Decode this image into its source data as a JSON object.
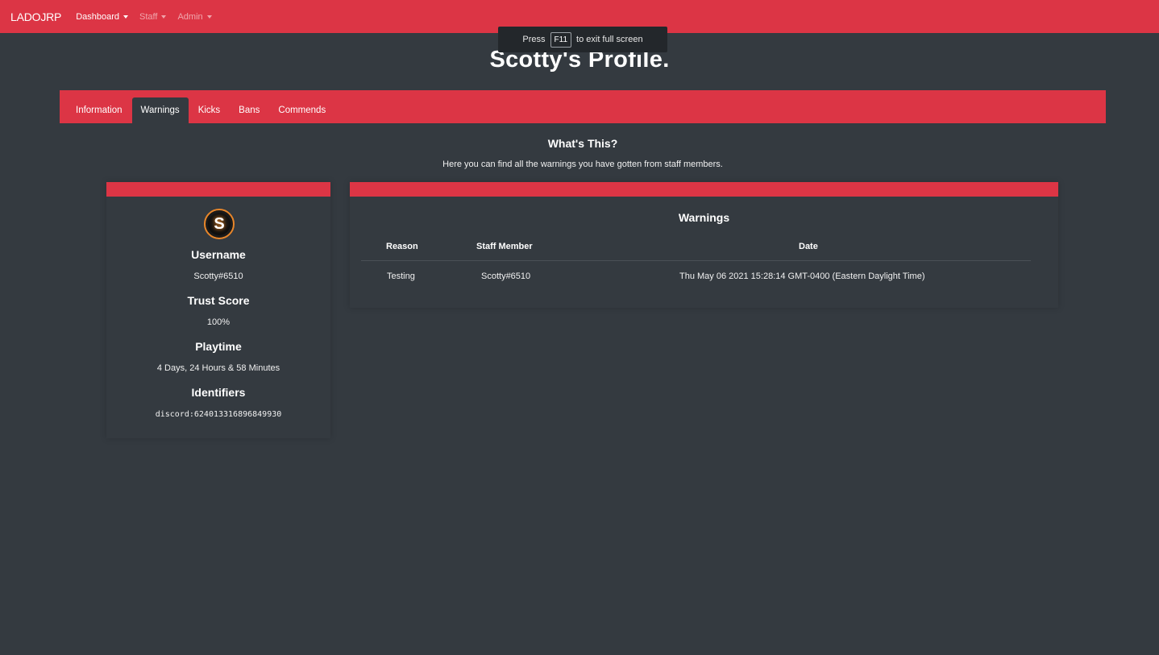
{
  "navbar": {
    "brand": "LADOJRP",
    "items": [
      {
        "label": "Dashboard"
      },
      {
        "label": "Staff"
      },
      {
        "label": "Admin"
      }
    ]
  },
  "fullscreen_toast": {
    "prefix": "Press",
    "key": "F11",
    "suffix": "to exit full screen"
  },
  "page": {
    "title": "Scotty's Profile."
  },
  "tabs": [
    {
      "label": "Information"
    },
    {
      "label": "Warnings"
    },
    {
      "label": "Kicks"
    },
    {
      "label": "Bans"
    },
    {
      "label": "Commends"
    }
  ],
  "info": {
    "heading": "What's This?",
    "description": "Here you can find all the warnings you have gotten from staff members."
  },
  "profile": {
    "avatar_letter": "S",
    "username_label": "Username",
    "username": "Scotty#6510",
    "trust_label": "Trust Score",
    "trust_score": "100%",
    "playtime_label": "Playtime",
    "playtime": "4 Days, 24 Hours & 58 Minutes",
    "identifiers_label": "Identifiers",
    "identifier": "discord:624013316896849930"
  },
  "warnings": {
    "title": "Warnings",
    "columns": {
      "reason": "Reason",
      "staff": "Staff Member",
      "date": "Date"
    },
    "rows": [
      {
        "reason": "Testing",
        "staff": "Scotty#6510",
        "date": "Thu May 06 2021 15:28:14 GMT-0400 (Eastern Daylight Time)"
      }
    ]
  },
  "colors": {
    "accent": "#dc3545",
    "background": "#343a40"
  }
}
